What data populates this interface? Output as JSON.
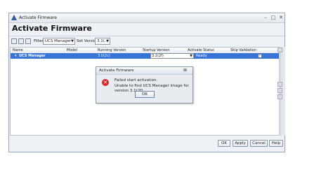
{
  "window": {
    "title": "Activate Firmware"
  },
  "heading": "Activate Firmware",
  "toolbar": {
    "filter_label": "Filter:",
    "filter_value": "UCS Manager",
    "set_version_label": "Set Version:",
    "set_version_value": "3.1(..."
  },
  "table": {
    "columns": [
      "Name",
      "Model",
      "Running Version",
      "Startup Version",
      "Activate Status",
      "Skip Validation"
    ],
    "rows": [
      {
        "name": "UCS Manager",
        "model": "",
        "running_version": "3.0(2c)",
        "startup_version": "3.1(2f)",
        "activate_status": "Ready",
        "skip_validation": "✓"
      }
    ]
  },
  "buttons": {
    "ok": "OK",
    "apply": "Apply",
    "cancel": "Cancel",
    "help": "Help"
  },
  "dialog": {
    "title": "Activate Firmware",
    "line1": "Failed start activation.",
    "line2": "Unable to find UCS Manager image for version 3.1(2f)",
    "ok": "OK"
  }
}
